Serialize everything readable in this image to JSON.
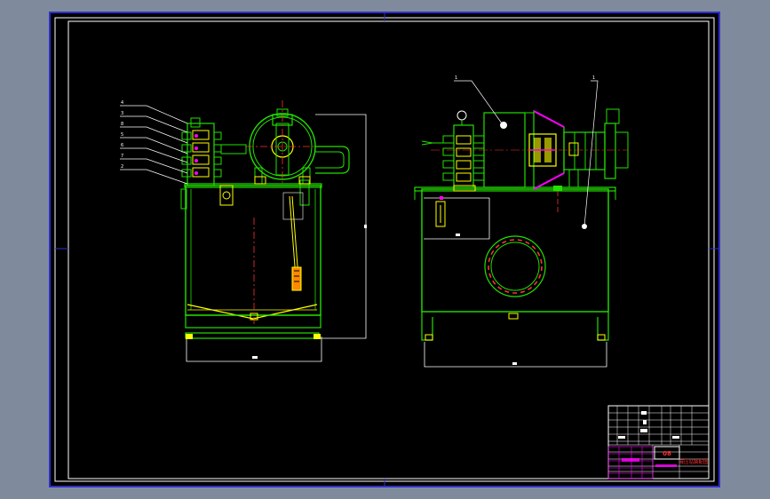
{
  "drawing": {
    "background_color": "#000000",
    "outer_background_color": "#7f8b9c",
    "frame_color": "#ffffff",
    "border_color": "#2f2fc8",
    "part_color": "#22e000",
    "hatch_color": "#ffff00",
    "axis_color": "#ff3030",
    "fitting_color": "#ff00ff",
    "left_view": {
      "callouts": [
        "4",
        "3",
        "8",
        "5",
        "6",
        "7",
        "2"
      ]
    },
    "right_view": {
      "callouts": [
        "1",
        "1"
      ]
    },
    "title_block": {
      "drawing_number": "08",
      "title_text": "液压站装配图"
    }
  }
}
